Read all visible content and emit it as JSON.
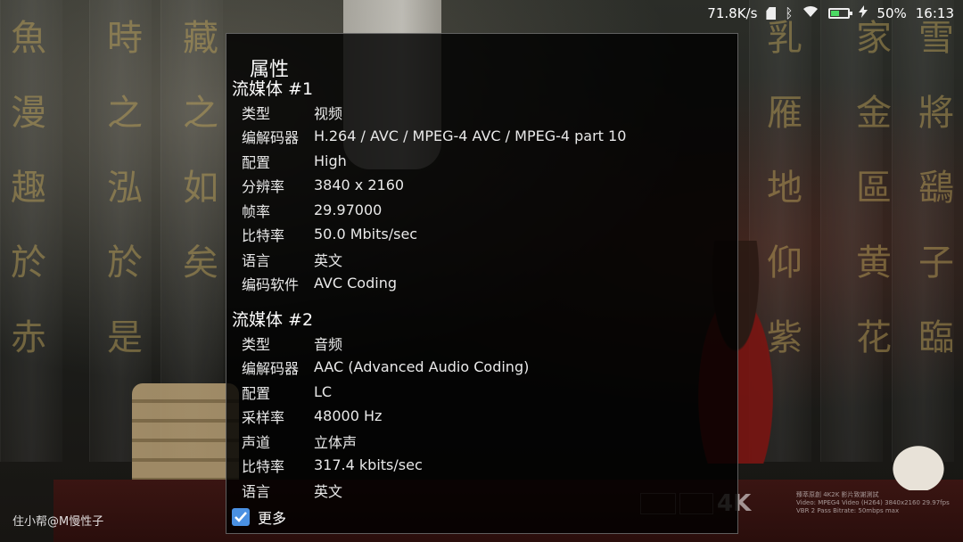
{
  "status_bar": {
    "net_speed": "71.8K/s",
    "battery_percent": "50%",
    "battery_level": 0.5,
    "battery_color": "#4cd964",
    "time": "16:13",
    "icons": [
      "sd-card-icon",
      "bluetooth-icon",
      "wifi-icon",
      "battery-icon",
      "charging-icon"
    ]
  },
  "dialog": {
    "title": "属性",
    "streams": [
      {
        "heading": "流媒体 #1",
        "rows": [
          {
            "label": "类型",
            "value": "视频"
          },
          {
            "label": "编解码器",
            "value": "H.264 / AVC / MPEG-4 AVC / MPEG-4 part 10"
          },
          {
            "label": "配置",
            "value": "High"
          },
          {
            "label": "分辨率",
            "value": "3840 x 2160"
          },
          {
            "label": "帧率",
            "value": "29.97000"
          },
          {
            "label": "比特率",
            "value": "50.0 Mbits/sec"
          },
          {
            "label": "语言",
            "value": "英文"
          },
          {
            "label": "编码软件",
            "value": "AVC Coding"
          }
        ]
      },
      {
        "heading": "流媒体 #2",
        "rows": [
          {
            "label": "类型",
            "value": "音频"
          },
          {
            "label": "编解码器",
            "value": "AAC (Advanced Audio Coding)"
          },
          {
            "label": "配置",
            "value": "LC"
          },
          {
            "label": "采样率",
            "value": "48000 Hz"
          },
          {
            "label": "声道",
            "value": "立体声"
          },
          {
            "label": "比特率",
            "value": "317.4 kbits/sec"
          },
          {
            "label": "语言",
            "value": "英文"
          }
        ]
      }
    ],
    "more_label": "更多",
    "more_checked": true,
    "checkbox_color": "#4a90e2"
  },
  "watermark": "住小帮@M慢性子",
  "background": {
    "caption_line1": "臻萃原創 4K2K 影片致謝測試",
    "caption_line2": "Video: MPEG4 Video (H264) 3840x2160 29.97fps",
    "caption_line3": "VBR 2 Pass Bitrate: 50mbps max",
    "logo_4k": "4K"
  }
}
